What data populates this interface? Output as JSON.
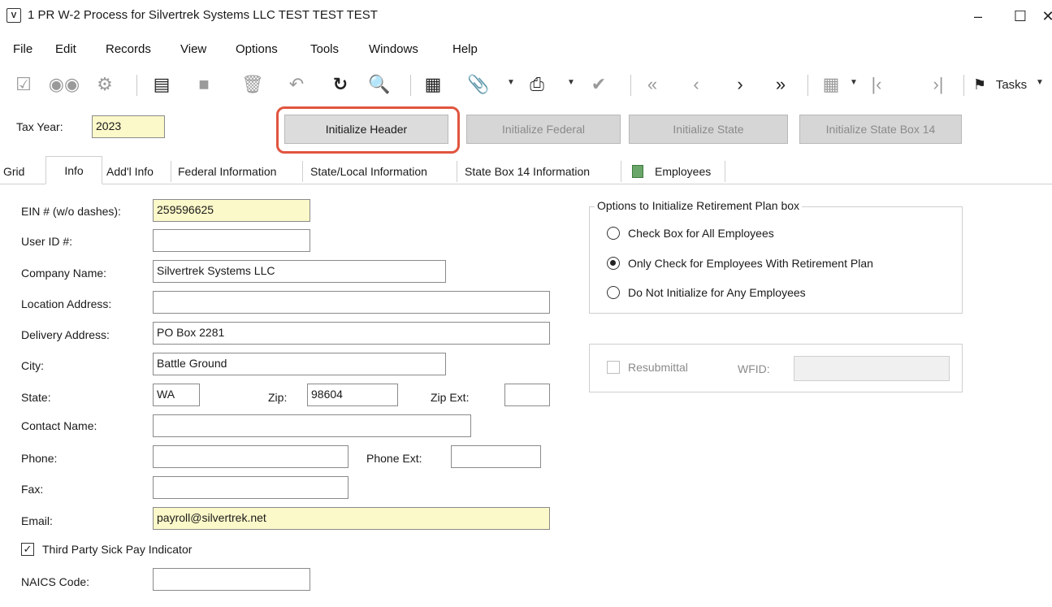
{
  "window": {
    "title": "1 PR W-2 Process for Silvertrek Systems LLC TEST TEST TEST",
    "minimize": "–",
    "maximize": "☐",
    "close": "✕"
  },
  "menu": [
    "File",
    "Edit",
    "Records",
    "View",
    "Options",
    "Tools",
    "Windows",
    "Help"
  ],
  "toolbar": {
    "tasks_label": "Tasks",
    "icons": [
      "approve-icon",
      "binoculars-icon",
      "settings-check-icon",
      "new-document-icon",
      "save-icon",
      "delete-icon",
      "undo-icon",
      "refresh-icon",
      "search-icon",
      "calculator-icon",
      "attachment-icon",
      "print-icon",
      "spellcheck-icon",
      "first-record-icon",
      "previous-record-icon",
      "next-record-icon",
      "last-record-icon",
      "grid-settings-icon",
      "go-first-icon",
      "go-last-icon",
      "flag-icon"
    ]
  },
  "header": {
    "tax_year_label": "Tax Year:",
    "tax_year_value": "2023",
    "buttons": {
      "init_header": "Initialize Header",
      "init_federal": "Initialize Federal",
      "init_state": "Initialize State",
      "init_state_box14": "Initialize State Box 14"
    }
  },
  "tabs": [
    "Grid",
    "Info",
    "Add'l Info",
    "Federal Information",
    "State/Local Information",
    "State Box 14 Information",
    "Employees"
  ],
  "form": {
    "ein_label": "EIN # (w/o dashes):",
    "ein_value": "259596625",
    "user_id_label": "User ID #:",
    "user_id_value": "",
    "company_label": "Company Name:",
    "company_value": "Silvertrek Systems LLC",
    "location_label": "Location Address:",
    "location_value": "",
    "delivery_label": "Delivery Address:",
    "delivery_value": "PO Box 2281",
    "city_label": "City:",
    "city_value": "Battle Ground",
    "state_label": "State:",
    "state_value": "WA",
    "zip_label": "Zip:",
    "zip_value": "98604",
    "zipext_label": "Zip Ext:",
    "zipext_value": "",
    "contact_label": "Contact Name:",
    "contact_value": "",
    "phone_label": "Phone:",
    "phone_value": "",
    "phoneext_label": "Phone Ext:",
    "phoneext_value": "",
    "fax_label": "Fax:",
    "fax_value": "",
    "email_label": "Email:",
    "email_value": "payroll@silvertrek.net",
    "third_party_label": "Third Party Sick Pay Indicator",
    "third_party_checked": true,
    "naics_label": "NAICS Code:",
    "naics_value": ""
  },
  "retirement": {
    "title": "Options to Initialize Retirement Plan box",
    "options": [
      "Check Box for All Employees",
      "Only Check for Employees With Retirement Plan",
      "Do Not Initialize for Any Employees"
    ],
    "selected_index": 1
  },
  "resubmittal": {
    "label": "Resubmittal",
    "wfid_label": "WFID:",
    "wfid_value": ""
  }
}
